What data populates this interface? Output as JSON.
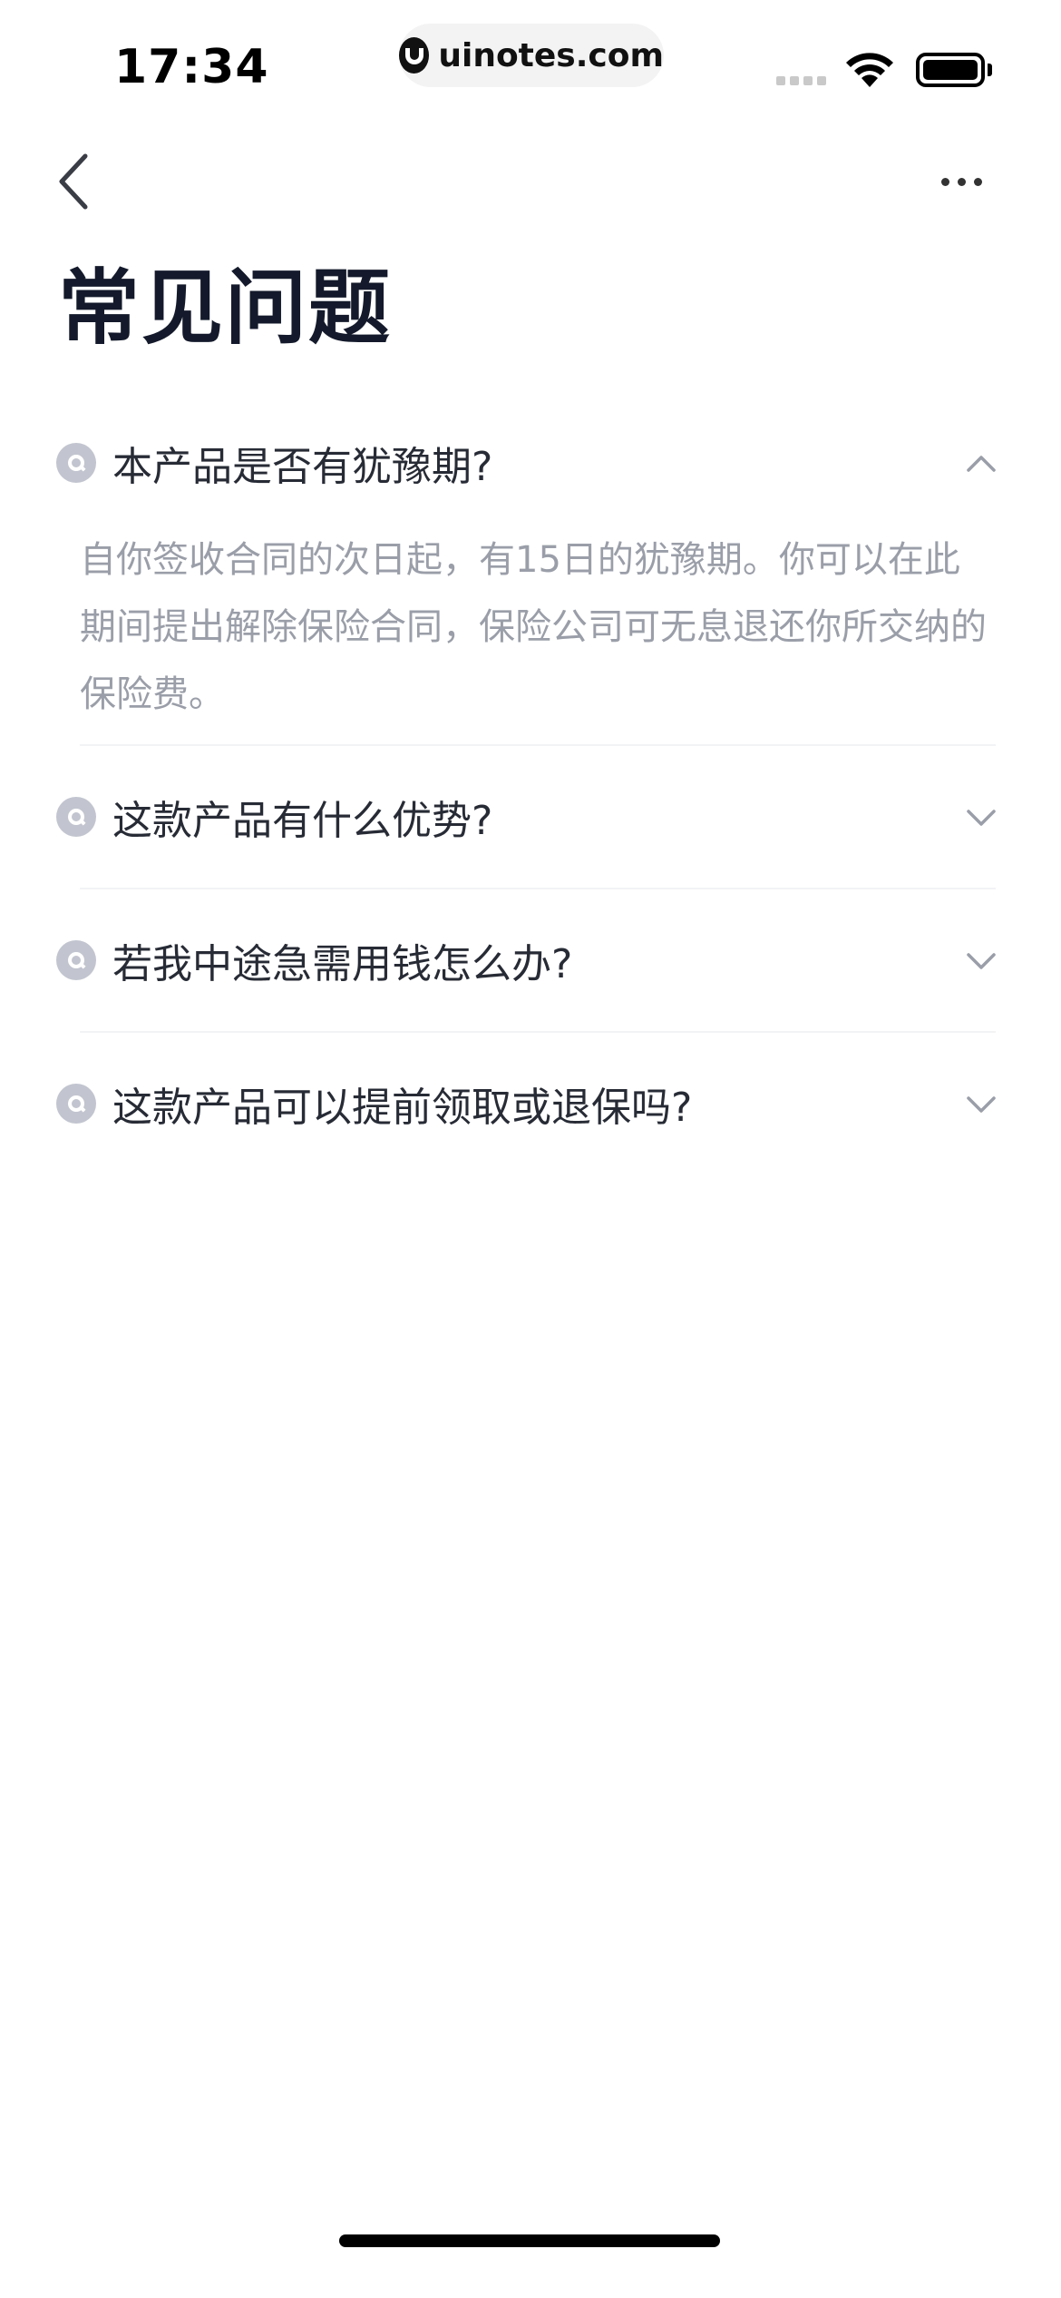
{
  "status_bar": {
    "time": "17:34",
    "url": "uinotes.com"
  },
  "nav": {
    "back_icon": "chevron-left-icon",
    "more_icon": "more-dots-icon"
  },
  "page": {
    "title": "常见问题"
  },
  "faq": [
    {
      "question": "本产品是否有犹豫期?",
      "expanded": true,
      "answer": "自你签收合同的次日起，有15日的犹豫期。你可以在此期间提出解除保险合同，保险公司可无息退还你所交纳的保险费。"
    },
    {
      "question": "这款产品有什么优势?",
      "expanded": false
    },
    {
      "question": "若我中途急需用钱怎么办?",
      "expanded": false
    },
    {
      "question": "这款产品可以提前领取或退保吗?",
      "expanded": false
    }
  ],
  "colors": {
    "title": "#141a2b",
    "question_text": "#272b35",
    "answer_text": "#9a9ea8",
    "icon_gray": "#c2c5cf",
    "divider": "#f2f3f5"
  }
}
